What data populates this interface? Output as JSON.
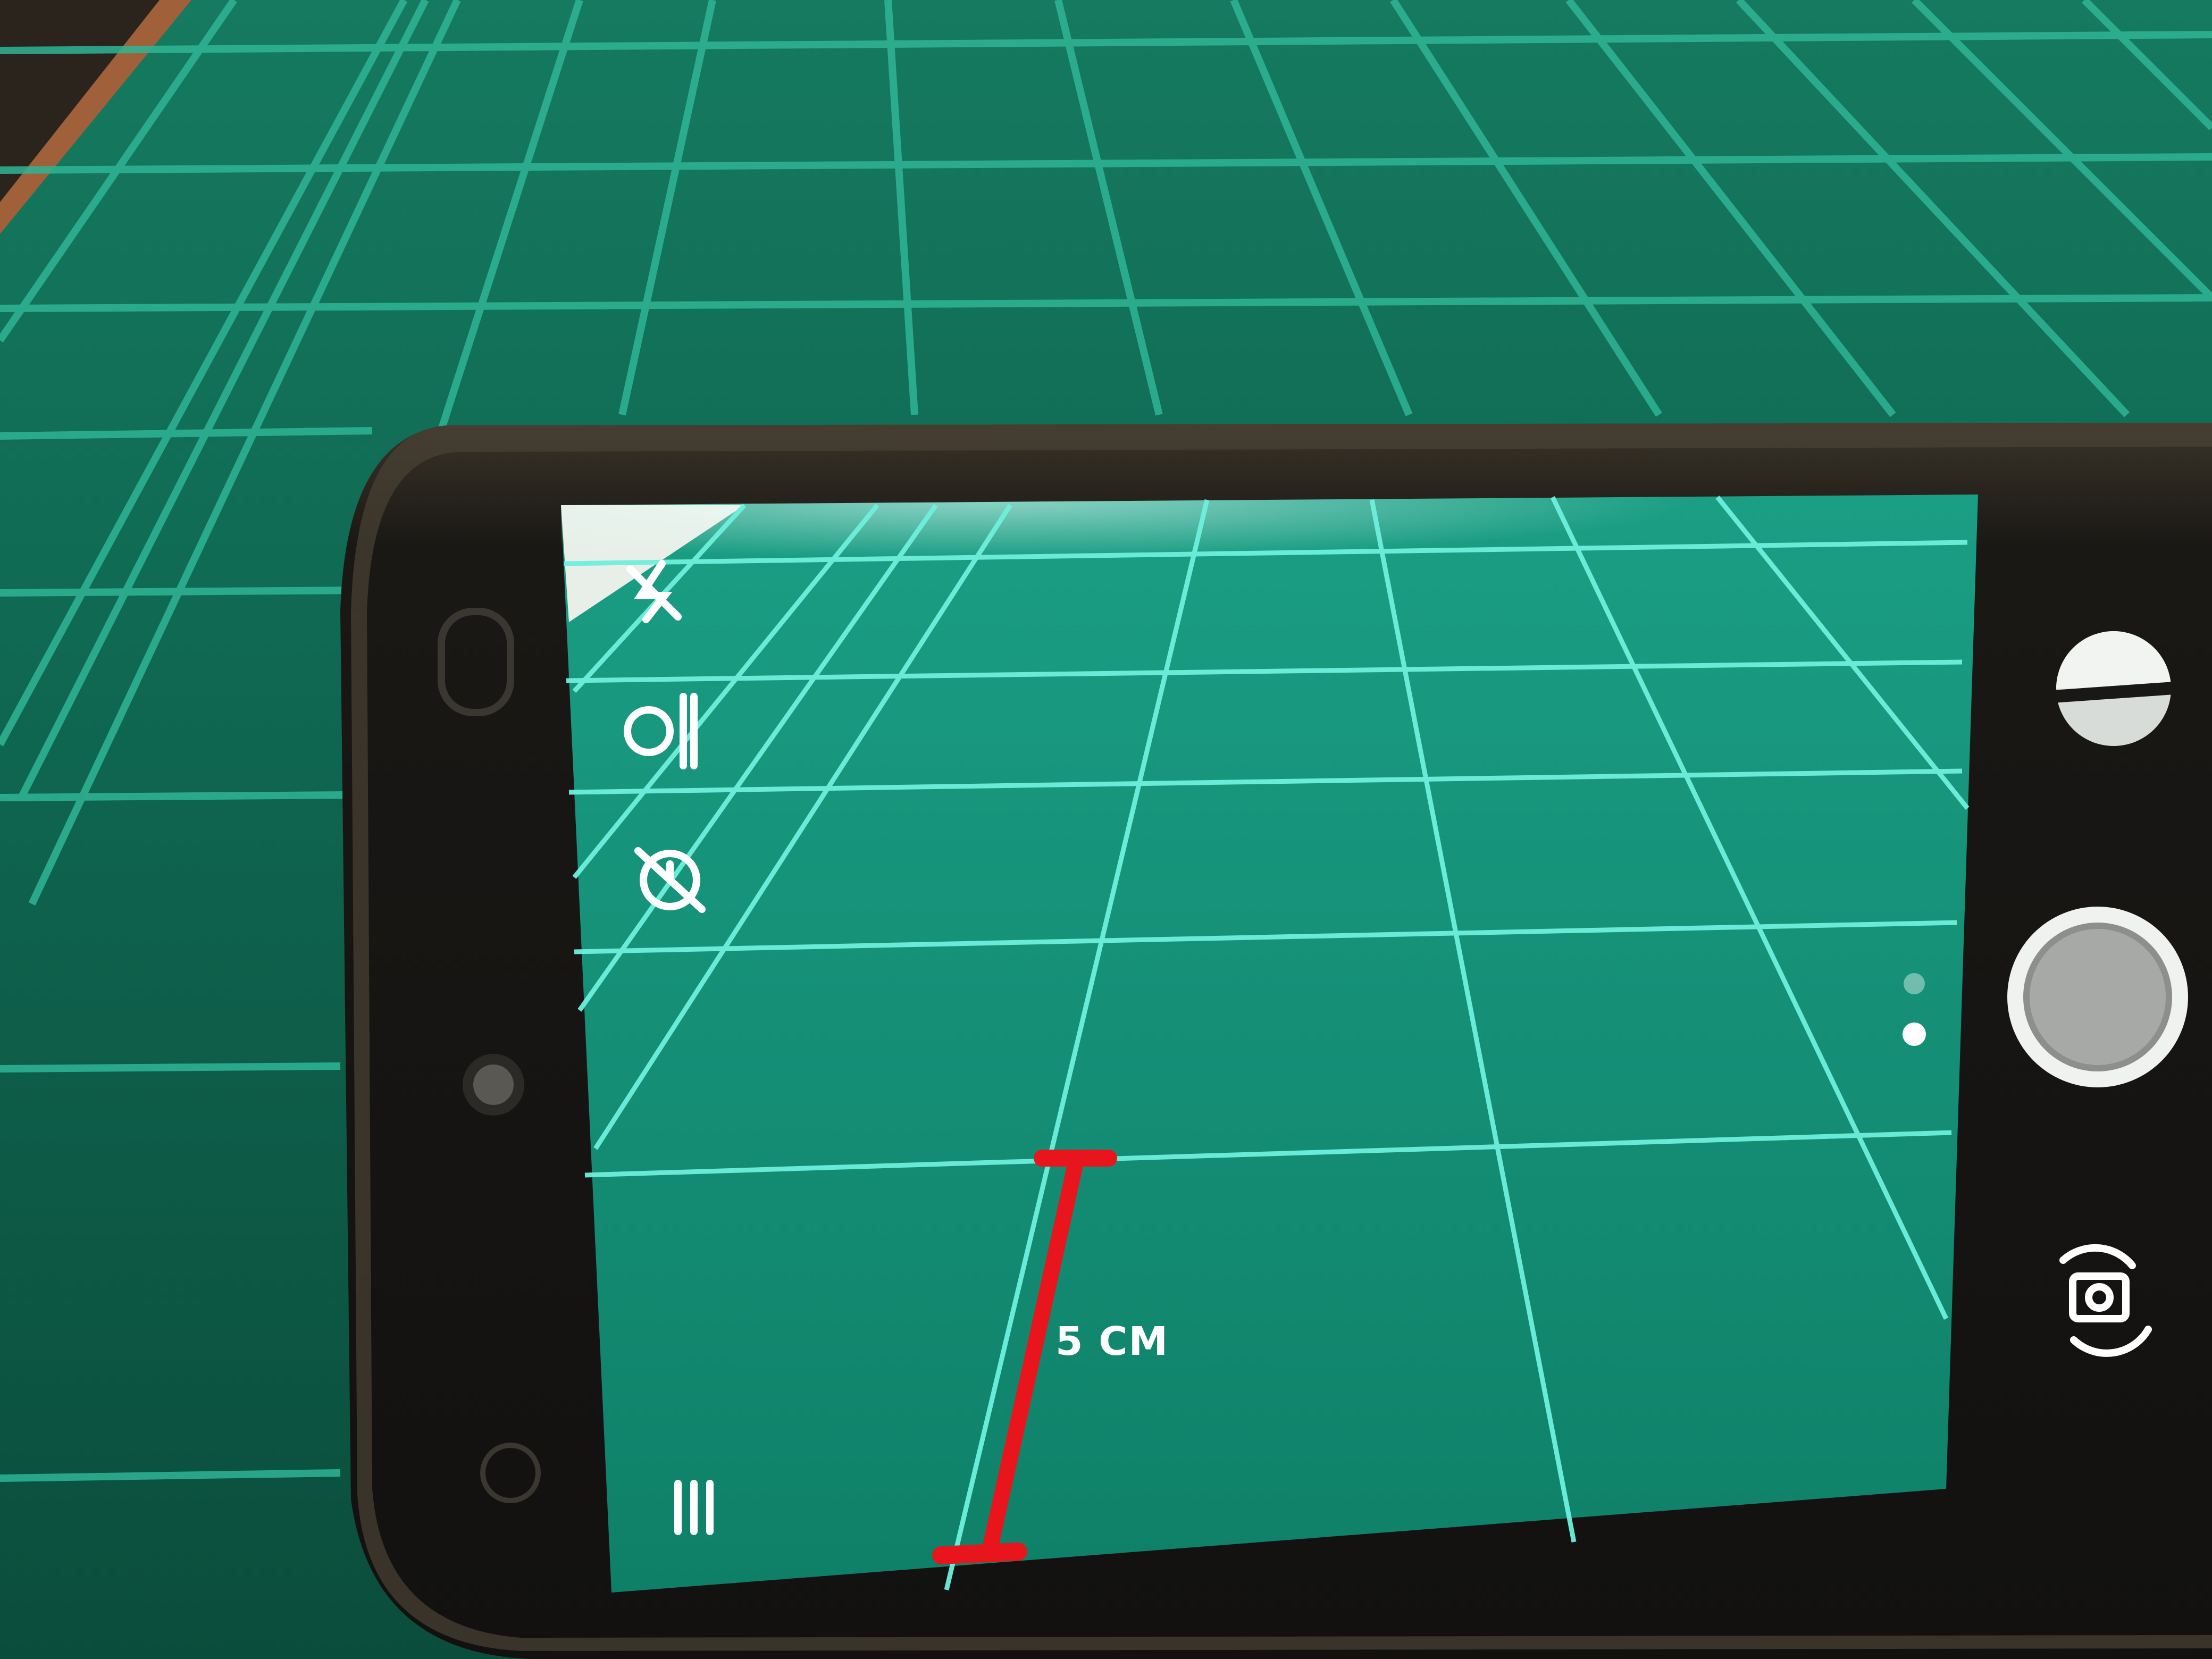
{
  "annotation": {
    "measurement_label": "5 CM",
    "measure_color": "#e8161c"
  },
  "camera_ui": {
    "left_controls": [
      "flash-off-icon",
      "face-hdr-plus-icon",
      "timer-off-icon",
      "menu-icon"
    ],
    "right_controls": [
      "exposure-icon",
      "shutter-button",
      "mode-indicator",
      "switch-camera-icon"
    ]
  },
  "colors": {
    "mat_green": "#0f5e49",
    "mat_line": "#2fb596",
    "screen_green": "#129078",
    "screen_line": "#6ef0dd",
    "phone_body": "#1b1a18"
  }
}
